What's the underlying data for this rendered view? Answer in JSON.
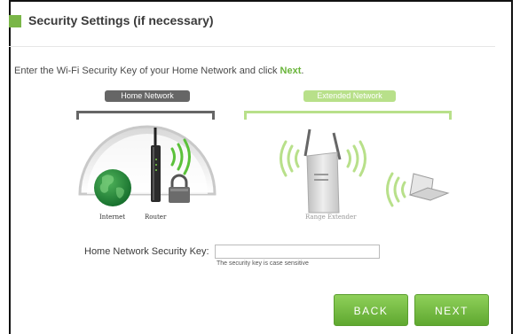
{
  "header": {
    "title": "Security Settings (if necessary)"
  },
  "instruction": {
    "text_before": "Enter the Wi-Fi Security Key of your Home Network and click ",
    "emphasis": "Next",
    "text_after": "."
  },
  "diagram": {
    "home_network_label": "Home Network",
    "extended_network_label": "Extended Network",
    "internet_label": "Internet",
    "router_label": "Router",
    "range_extender_label": "Range Extender"
  },
  "form": {
    "security_key_label": "Home Network Security Key:",
    "security_key_value": "",
    "security_key_hint": "The security key is case sensitive"
  },
  "buttons": {
    "back_label": "BACK",
    "next_label": "NEXT"
  },
  "colors": {
    "accent_green": "#7ab648",
    "button_green": "#6ab83a",
    "home_network_gray": "#666666",
    "extended_network_light_green": "#b8e08a"
  }
}
